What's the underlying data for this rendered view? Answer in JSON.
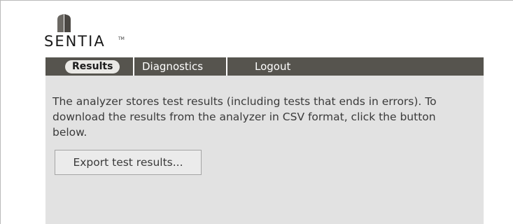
{
  "brand": {
    "name": "SENTIA",
    "trademark": "TM"
  },
  "nav": {
    "tabs": [
      {
        "label": "Results",
        "active": true
      },
      {
        "label": "Diagnostics",
        "active": false
      },
      {
        "label": "Logout",
        "active": false
      }
    ]
  },
  "main": {
    "description": "The analyzer stores test results (including tests that ends in errors). To download the results from the analyzer in CSV format, click the button below.",
    "export_button": "Export test results..."
  },
  "colors": {
    "navbar": "#56544e",
    "panel": "#e2e2e2",
    "active_tab": "#eae9e6",
    "text": "#3a3a3a"
  }
}
